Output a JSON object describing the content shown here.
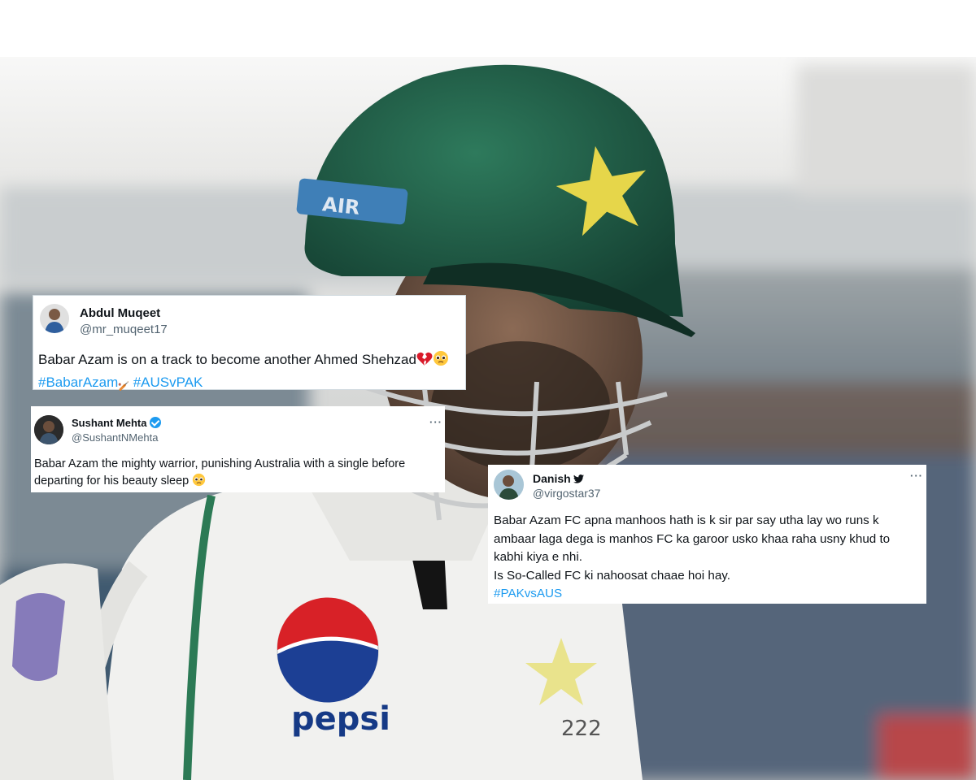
{
  "photo": {
    "helmet_sticker": "AIR",
    "jersey_logo": "pepsi",
    "jersey_number": "222",
    "colors": {
      "helmet": "#1f5c45",
      "star": "#e8d84a",
      "jersey": "#f4f4f2"
    }
  },
  "tweets": [
    {
      "name": "Abdul Muqeet",
      "handle": "@mr_muqeet17",
      "text": "Babar Azam is on a track to become another Ahmed Shehzad",
      "emojis": [
        "broken-heart-icon",
        "pleading-face-icon"
      ],
      "hashtags": [
        "#BabarAzam",
        "#AUSvPAK"
      ]
    },
    {
      "name": "Sushant Mehta",
      "handle": "@SushantNMehta",
      "verified": true,
      "more": "···",
      "text_line1": "Babar Azam the mighty warrior, punishing Australia with a single before",
      "text_line2": "departing for his beauty sleep",
      "emojis": [
        "pleading-face-icon"
      ]
    },
    {
      "name": "Danish",
      "handle": "@virgostar37",
      "more": "···",
      "line1": "Babar Azam FC apna manhoos hath is k sir par say utha lay wo runs k",
      "line2": "ambaar laga dega is manhos FC ka garoor usko khaa raha usny khud to",
      "line3": "kabhi kiya e nhi.",
      "line4": "Is So-Called FC ki nahoosat chaae hoi hay.",
      "hashtag": "#PAKvsAUS"
    }
  ]
}
